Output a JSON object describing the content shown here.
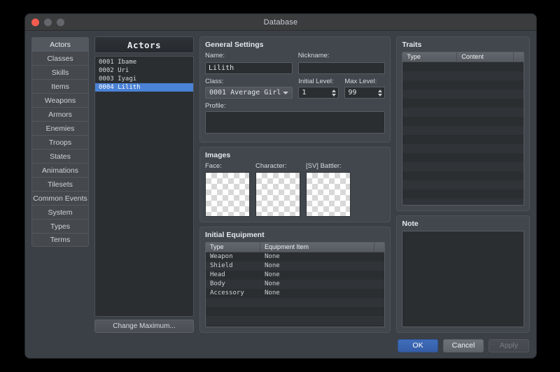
{
  "window": {
    "title": "Database",
    "traffic_lights": [
      "close",
      "minimize",
      "maximize"
    ]
  },
  "sidebar": {
    "items": [
      {
        "label": "Actors",
        "active": true
      },
      {
        "label": "Classes",
        "active": false
      },
      {
        "label": "Skills",
        "active": false
      },
      {
        "label": "Items",
        "active": false
      },
      {
        "label": "Weapons",
        "active": false
      },
      {
        "label": "Armors",
        "active": false
      },
      {
        "label": "Enemies",
        "active": false
      },
      {
        "label": "Troops",
        "active": false
      },
      {
        "label": "States",
        "active": false
      },
      {
        "label": "Animations",
        "active": false
      },
      {
        "label": "Tilesets",
        "active": false
      },
      {
        "label": "Common Events",
        "active": false
      },
      {
        "label": "System",
        "active": false
      },
      {
        "label": "Types",
        "active": false
      },
      {
        "label": "Terms",
        "active": false
      }
    ]
  },
  "actor_list": {
    "header": "Actors",
    "items": [
      {
        "text": "0001 Ibame",
        "selected": false
      },
      {
        "text": "0002 Uri",
        "selected": false
      },
      {
        "text": "0003 Iyagi",
        "selected": false
      },
      {
        "text": "0004 Lilith",
        "selected": true
      }
    ],
    "change_maximum_label": "Change Maximum..."
  },
  "general_settings": {
    "title": "General Settings",
    "name_label": "Name:",
    "name_value": "Lilith",
    "nickname_label": "Nickname:",
    "nickname_value": "",
    "class_label": "Class:",
    "class_value": "0001 Average Girl",
    "initial_level_label": "Initial Level:",
    "initial_level_value": "1",
    "max_level_label": "Max Level:",
    "max_level_value": "99",
    "profile_label": "Profile:",
    "profile_value": ""
  },
  "images": {
    "title": "Images",
    "slots": [
      {
        "label": "Face:",
        "value": ""
      },
      {
        "label": "Character:",
        "value": ""
      },
      {
        "label": "[SV] Battler:",
        "value": ""
      }
    ]
  },
  "initial_equipment": {
    "title": "Initial Equipment",
    "columns": [
      "Type",
      "Equipment Item"
    ],
    "rows": [
      {
        "type": "Weapon",
        "item": "None"
      },
      {
        "type": "Shield",
        "item": "None"
      },
      {
        "type": "Head",
        "item": "None"
      },
      {
        "type": "Body",
        "item": "None"
      },
      {
        "type": "Accessory",
        "item": "None"
      }
    ]
  },
  "traits": {
    "title": "Traits",
    "columns": [
      "Type",
      "Content"
    ],
    "rows": []
  },
  "note": {
    "title": "Note",
    "value": ""
  },
  "footer": {
    "ok_label": "OK",
    "cancel_label": "Cancel",
    "apply_label": "Apply"
  },
  "colors": {
    "selection_blue": "#4a82d6",
    "primary_button": "#355da6",
    "window_bg": "#3b4046",
    "field_bg": "#2b2e31"
  }
}
